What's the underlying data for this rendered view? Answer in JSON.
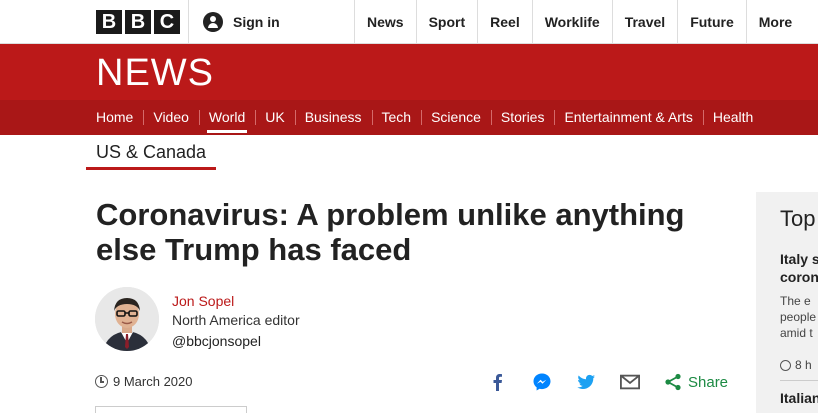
{
  "header": {
    "logo_letters": [
      "B",
      "B",
      "C"
    ],
    "signin_label": "Sign in",
    "links": [
      "News",
      "Sport",
      "Reel",
      "Worklife",
      "Travel",
      "Future",
      "More"
    ]
  },
  "banner": {
    "title": "NEWS",
    "color": "#bb1919"
  },
  "nav": {
    "items": [
      "Home",
      "Video",
      "World",
      "UK",
      "Business",
      "Tech",
      "Science",
      "Stories",
      "Entertainment & Arts",
      "Health"
    ],
    "active": "World"
  },
  "subnav": {
    "label": "US & Canada"
  },
  "article": {
    "headline": "Coronavirus: A problem unlike anything else Trump has faced",
    "author": {
      "name": "Jon Sopel",
      "role": "North America editor",
      "handle": "@bbcjonsopel"
    },
    "date": "9 March 2020"
  },
  "share": {
    "label": "Share",
    "icons": [
      "facebook-icon",
      "messenger-icon",
      "twitter-icon",
      "email-icon",
      "share-icon"
    ],
    "accent": "#1c8a43"
  },
  "sidebar": {
    "title": "Top",
    "story1": {
      "headline_lines": [
        "Italy s",
        "coron"
      ],
      "body_lines": [
        "The e",
        "people",
        "amid t"
      ],
      "time": "8 h"
    },
    "story2": {
      "headline": "Italian"
    }
  }
}
